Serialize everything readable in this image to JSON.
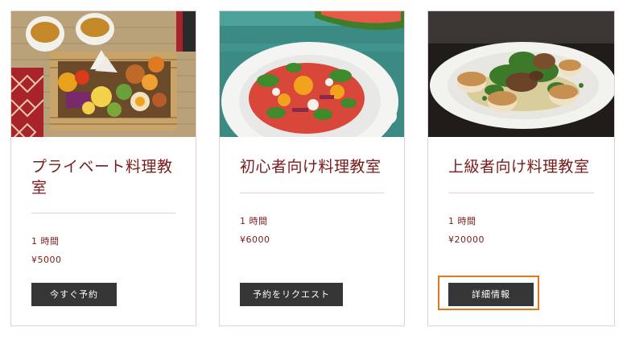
{
  "cards": [
    {
      "title": "プライベート料理教室",
      "duration": "1 時間",
      "price": "¥5000",
      "button_label": "今すぐ予約",
      "image_icon": "japanese-bento-photo"
    },
    {
      "title": "初心者向け料理教室",
      "duration": "1 時間",
      "price": "¥6000",
      "button_label": "予約をリクエスト",
      "image_icon": "tomato-salad-photo"
    },
    {
      "title": "上級者向け料理教室",
      "duration": "1 時間",
      "price": "¥20000",
      "button_label": "詳細情報",
      "image_icon": "scallop-dish-photo",
      "focused": true
    }
  ],
  "colors": {
    "title": "#7a1a1a",
    "border": "#e6cfcf",
    "button_bg": "#363636",
    "focus": "#e4761c"
  }
}
